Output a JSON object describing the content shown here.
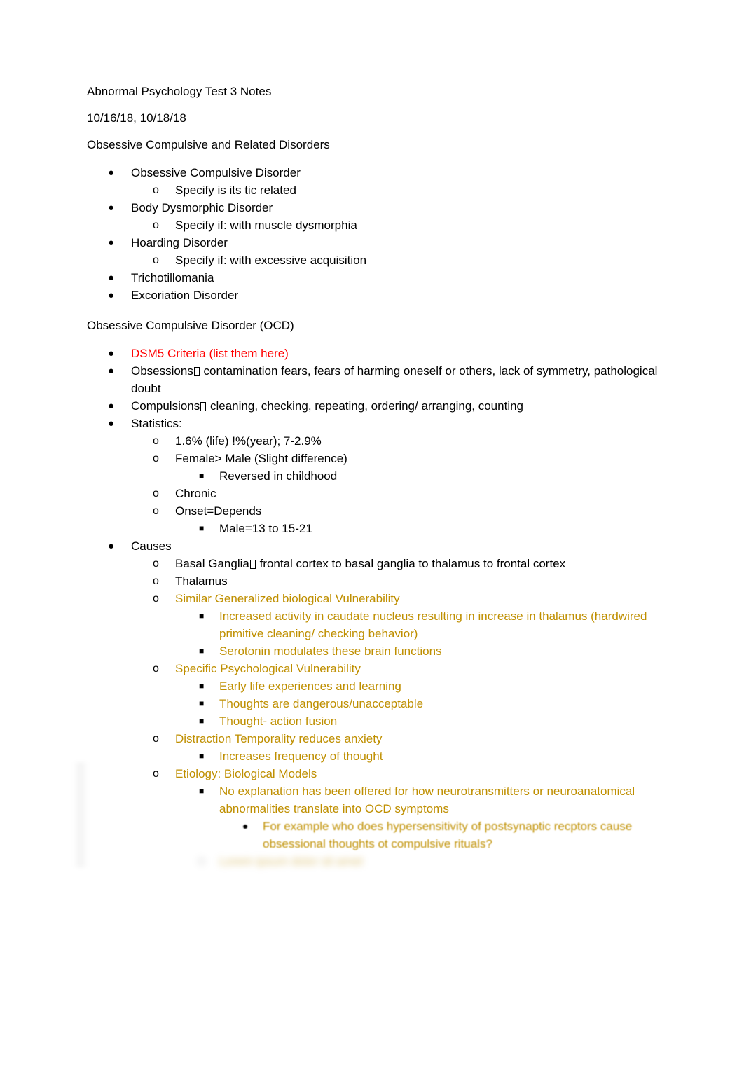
{
  "document": {
    "title": "Abnormal Psychology Test 3 Notes",
    "dates": "10/16/18, 10/18/18",
    "section_heading_1": "Obsessive Compulsive and Related Disorders",
    "section_heading_2": "Obsessive Compulsive Disorder (OCD)"
  },
  "colors": {
    "body_text": "#000000",
    "highlight_red": "#FF0000",
    "highlight_gold": "#BF8F00",
    "page_background": "#FFFFFF"
  },
  "markers": {
    "bullet_round": "●",
    "bullet_letter_o": "o",
    "bullet_square": "■",
    "missing_glyph": "□"
  },
  "related_disorders": [
    {
      "level": 1,
      "color": "black",
      "text": "Obsessive Compulsive Disorder"
    },
    {
      "level": 2,
      "color": "black",
      "text": "Specify is its tic related"
    },
    {
      "level": 1,
      "color": "black",
      "text": "Body Dysmorphic Disorder"
    },
    {
      "level": 2,
      "color": "black",
      "text": "Specify if: with muscle dysmorphia"
    },
    {
      "level": 1,
      "color": "black",
      "text": "Hoarding Disorder"
    },
    {
      "level": 2,
      "color": "black",
      "text": "Specify if: with excessive acquisition"
    },
    {
      "level": 1,
      "color": "black",
      "text": "Trichotillomania"
    },
    {
      "level": 1,
      "color": "black",
      "text": "Excoriation Disorder"
    }
  ],
  "ocd": {
    "dsm5_line": "DSM5 Criteria (list them here)",
    "obsessions_label": "Obsessions",
    "obsessions_rest": " contamination fears, fears of harming oneself or others, lack of symmetry, pathological doubt",
    "compulsions_label": "Compulsions",
    "compulsions_rest": " cleaning, checking, repeating, ordering/ arranging, counting",
    "statistics_label": "Statistics:",
    "statistics": [
      {
        "level": 2,
        "text": "1.6% (life) !%(year); 7-2.9%"
      },
      {
        "level": 2,
        "text": "Female> Male (Slight difference)"
      },
      {
        "level": 3,
        "text": "Reversed in childhood"
      },
      {
        "level": 2,
        "text": "Chronic"
      },
      {
        "level": 2,
        "text": "Onset=Depends"
      },
      {
        "level": 3,
        "text": "Male=13 to 15-21"
      }
    ],
    "causes_label": "Causes",
    "basal_ganglia_label": "Basal Ganglia",
    "basal_ganglia_rest": " frontal cortex to basal ganglia to thalamus to frontal cortex",
    "thalamus": "Thalamus",
    "causes": [
      {
        "level": 2,
        "color": "gold",
        "text": "Similar Generalized biological Vulnerability"
      },
      {
        "level": 3,
        "color": "gold",
        "text": "Increased activity in caudate nucleus resulting in increase in thalamus (hardwired primitive cleaning/ checking behavior)"
      },
      {
        "level": 3,
        "color": "gold",
        "text": "Serotonin modulates these brain functions"
      },
      {
        "level": 2,
        "color": "gold",
        "text": "Specific Psychological Vulnerability"
      },
      {
        "level": 3,
        "color": "gold",
        "text": "Early life experiences and learning"
      },
      {
        "level": 3,
        "color": "gold",
        "text": "Thoughts are dangerous/unacceptable"
      },
      {
        "level": 3,
        "color": "gold",
        "text": "Thought- action fusion"
      },
      {
        "level": 2,
        "color": "gold",
        "text": "Distraction Temporality reduces anxiety"
      },
      {
        "level": 3,
        "color": "gold",
        "text": "Increases frequency of thought"
      },
      {
        "level": 2,
        "color": "gold",
        "text": "Etiology: Biological Models"
      },
      {
        "level": 3,
        "color": "gold",
        "text": "No explanation has been offered for how neurotransmitters or neuroanatomical abnormalities translate into OCD symptoms"
      },
      {
        "level": 4,
        "color": "gold",
        "text": "For example who does hypersensitivity of postsynaptic recptors cause obsessional thoughts ot compulsive rituals?"
      }
    ],
    "cut_off_line": {
      "level": 3,
      "color": "gold",
      "text": "Lorem ipsum dolor sit amet"
    }
  }
}
